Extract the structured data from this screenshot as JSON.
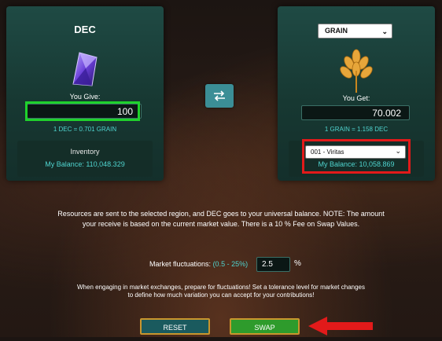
{
  "left_panel": {
    "title": "DEC",
    "give_label": "You Give:",
    "give_value": "100",
    "rate": "1 DEC = 0.701 GRAIN",
    "inventory_title": "Inventory",
    "balance": "My Balance: 110,048.329"
  },
  "right_panel": {
    "resource_select": "GRAIN",
    "get_label": "You Get:",
    "get_value": "70.002",
    "rate": "1 GRAIN = 1.158 DEC",
    "region_select": "001 - Viritas",
    "balance": "My Balance: 10,058.869"
  },
  "info_text": "Resources are sent to the selected region, and DEC goes to your universal balance. NOTE: The amount your receive is based on the current market value. There is a 10 % Fee on Swap Values.",
  "fluctuations": {
    "label": "Market fluctuations:",
    "range": "(0.5 - 25%)",
    "value": "2.5",
    "unit": "%"
  },
  "note_text": "When engaging in market exchanges, prepare for fluctuations! Set a tolerance level for market changes to define how much variation you can accept for your contributions!",
  "buttons": {
    "reset": "RESET",
    "swap": "SWAP"
  },
  "colors": {
    "accent_teal": "#4fd4cf",
    "highlight_green": "#1fd22c",
    "highlight_red": "#e21a1a",
    "swap_button": "#2e9b2c"
  },
  "icons": {
    "left": "dec-crystal-icon",
    "right": "grain-wheat-icon",
    "swap": "swap-arrows-icon"
  }
}
